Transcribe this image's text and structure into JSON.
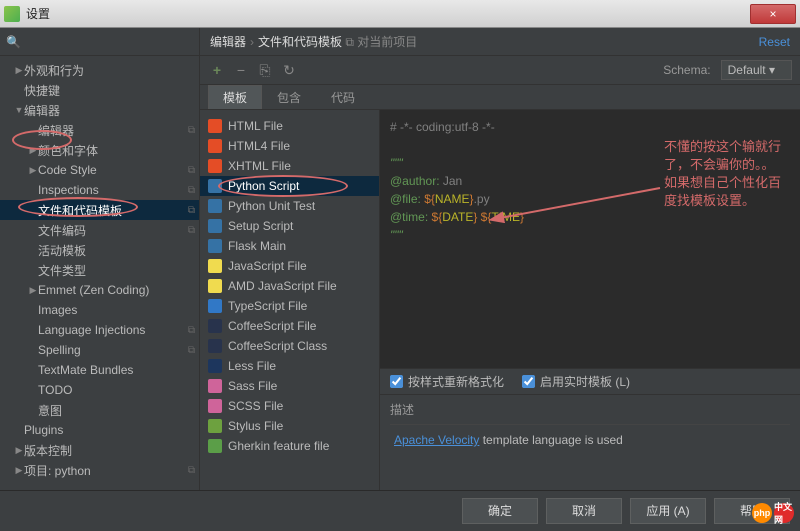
{
  "window": {
    "title": "设置",
    "close": "×"
  },
  "search": {
    "icon": "🔍"
  },
  "tree": [
    {
      "label": "外观和行为",
      "depth": 0,
      "arrow": "▶",
      "sel": false
    },
    {
      "label": "快捷键",
      "depth": 0,
      "arrow": "",
      "sel": false
    },
    {
      "label": "编辑器",
      "depth": 0,
      "arrow": "▼",
      "sel": false
    },
    {
      "label": "编辑器",
      "depth": 1,
      "arrow": "",
      "sel": false,
      "badge": "⧉"
    },
    {
      "label": "颜色和字体",
      "depth": 1,
      "arrow": "▶",
      "sel": false
    },
    {
      "label": "Code Style",
      "depth": 1,
      "arrow": "▶",
      "sel": false,
      "badge": "⧉"
    },
    {
      "label": "Inspections",
      "depth": 1,
      "arrow": "",
      "sel": false,
      "badge": "⧉"
    },
    {
      "label": "文件和代码模板",
      "depth": 1,
      "arrow": "",
      "sel": true,
      "badge": "⧉"
    },
    {
      "label": "文件编码",
      "depth": 1,
      "arrow": "",
      "sel": false,
      "badge": "⧉"
    },
    {
      "label": "活动模板",
      "depth": 1,
      "arrow": "",
      "sel": false
    },
    {
      "label": "文件类型",
      "depth": 1,
      "arrow": "",
      "sel": false
    },
    {
      "label": "Emmet (Zen Coding)",
      "depth": 1,
      "arrow": "▶",
      "sel": false
    },
    {
      "label": "Images",
      "depth": 1,
      "arrow": "",
      "sel": false
    },
    {
      "label": "Language Injections",
      "depth": 1,
      "arrow": "",
      "sel": false,
      "badge": "⧉"
    },
    {
      "label": "Spelling",
      "depth": 1,
      "arrow": "",
      "sel": false,
      "badge": "⧉"
    },
    {
      "label": "TextMate Bundles",
      "depth": 1,
      "arrow": "",
      "sel": false
    },
    {
      "label": "TODO",
      "depth": 1,
      "arrow": "",
      "sel": false
    },
    {
      "label": "意图",
      "depth": 1,
      "arrow": "",
      "sel": false
    },
    {
      "label": "Plugins",
      "depth": 0,
      "arrow": "",
      "sel": false
    },
    {
      "label": "版本控制",
      "depth": 0,
      "arrow": "▶",
      "sel": false
    },
    {
      "label": "项目: python",
      "depth": 0,
      "arrow": "▶",
      "sel": false,
      "badge": "⧉"
    }
  ],
  "breadcrumb": {
    "a": "编辑器",
    "b": "文件和代码模板",
    "proj": "对当前项目"
  },
  "reset": "Reset",
  "toolbar": {
    "add": "+",
    "remove": "−",
    "copy": "⎘",
    "refresh": "↻"
  },
  "schema": {
    "label": "Schema:",
    "value": "Default ▾"
  },
  "tabs": [
    {
      "label": "模板",
      "active": true
    },
    {
      "label": "包含",
      "active": false
    },
    {
      "label": "代码",
      "active": false
    }
  ],
  "files": [
    {
      "label": "HTML File",
      "color": "#e44d26",
      "sel": false
    },
    {
      "label": "HTML4 File",
      "color": "#e44d26",
      "sel": false
    },
    {
      "label": "XHTML File",
      "color": "#e44d26",
      "sel": false
    },
    {
      "label": "Python Script",
      "color": "#3572A5",
      "sel": true
    },
    {
      "label": "Python Unit Test",
      "color": "#3572A5",
      "sel": false
    },
    {
      "label": "Setup Script",
      "color": "#3572A5",
      "sel": false
    },
    {
      "label": "Flask Main",
      "color": "#3572A5",
      "sel": false
    },
    {
      "label": "JavaScript File",
      "color": "#f0db4f",
      "sel": false
    },
    {
      "label": "AMD JavaScript File",
      "color": "#f0db4f",
      "sel": false
    },
    {
      "label": "TypeScript File",
      "color": "#3178c6",
      "sel": false
    },
    {
      "label": "CoffeeScript File",
      "color": "#28334c",
      "sel": false
    },
    {
      "label": "CoffeeScript Class",
      "color": "#28334c",
      "sel": false
    },
    {
      "label": "Less File",
      "color": "#1d365d",
      "sel": false
    },
    {
      "label": "Sass File",
      "color": "#cf649a",
      "sel": false
    },
    {
      "label": "SCSS File",
      "color": "#cf649a",
      "sel": false
    },
    {
      "label": "Stylus File",
      "color": "#6da13f",
      "sel": false
    },
    {
      "label": "Gherkin feature file",
      "color": "#5B9E48",
      "sel": false
    }
  ],
  "editor": {
    "line1": "# -*- coding:utf-8 -*-",
    "line2": "\"\"\"",
    "line3a": "@author:",
    "line3b": " Jan",
    "line4a": "@file:",
    "line4b1": " ${",
    "line4b2": "NAME",
    "line4b3": "}",
    "line4b4": ".py",
    "line5a": "@time:",
    "line5b1": " ${",
    "line5b2": "DATE",
    "line5b3": "}",
    "line5b4": " ${",
    "line5b5": "TIME",
    "line5b6": "}",
    "line6": "\"\"\""
  },
  "opts": {
    "reformat": "按样式重新格式化",
    "live": "启用实时模板 (L)"
  },
  "desc": {
    "label": "描述",
    "link": "Apache Velocity",
    "rest": " template language is used"
  },
  "buttons": {
    "ok": "确定",
    "cancel": "取消",
    "apply": "应用 (A)",
    "help": "帮助"
  },
  "annotation": "不懂的按这个输就行了，不会骗你的。。如果想自己个性化百度找模板设置。",
  "watermark": {
    "a": "php",
    "b": "中文网"
  }
}
